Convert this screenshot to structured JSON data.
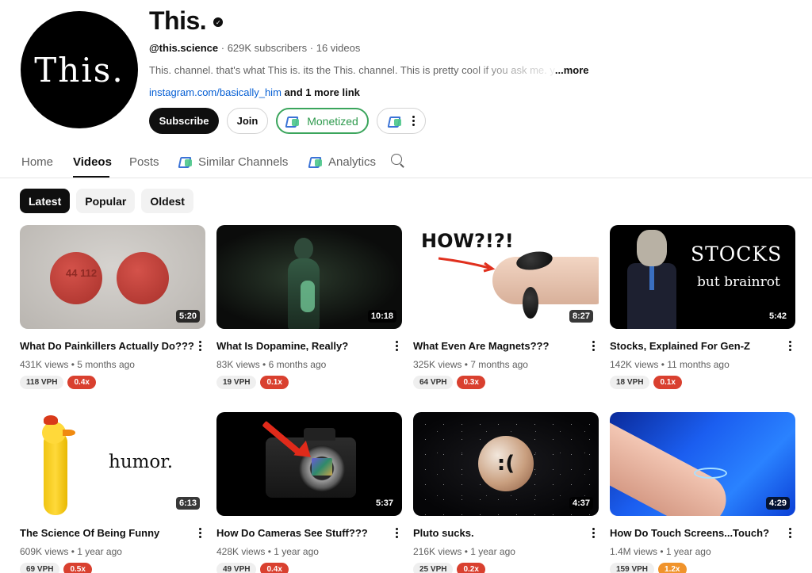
{
  "channel": {
    "name": "This.",
    "avatar_text": "This.",
    "handle": "@this.science",
    "subscribers": "629K subscribers",
    "videos_count": "16 videos",
    "description": "This. channel. that's what This is. its the This. channel. This is pretty cool if you ask me. y",
    "more_label": "...more",
    "link": "instagram.com/basically_him",
    "more_links": "and 1 more link"
  },
  "buttons": {
    "subscribe": "Subscribe",
    "join": "Join",
    "monetized": "Monetized"
  },
  "tabs": {
    "home": "Home",
    "videos": "Videos",
    "posts": "Posts",
    "similar": "Similar Channels",
    "analytics": "Analytics"
  },
  "filters": [
    "Latest",
    "Popular",
    "Oldest"
  ],
  "videos": [
    {
      "title": "What Do Painkillers Actually Do???",
      "views": "431K views",
      "age": "5 months ago",
      "duration": "5:20",
      "vph": "118 VPH",
      "ratio": "0.4x",
      "ratio_color": "#d9402f",
      "pill_text": "44 112"
    },
    {
      "title": "What Is Dopamine, Really?",
      "views": "83K views",
      "age": "6 months ago",
      "duration": "10:18",
      "vph": "19 VPH",
      "ratio": "0.1x",
      "ratio_color": "#d9402f"
    },
    {
      "title": "What Even Are Magnets???",
      "views": "325K views",
      "age": "7 months ago",
      "duration": "8:27",
      "vph": "64 VPH",
      "ratio": "0.3x",
      "ratio_color": "#d9402f",
      "thumb_text": "HOW?!?!"
    },
    {
      "title": "Stocks, Explained For Gen-Z",
      "views": "142K views",
      "age": "11 months ago",
      "duration": "5:42",
      "vph": "18 VPH",
      "ratio": "0.1x",
      "ratio_color": "#d9402f",
      "thumb_text": "STOCKS",
      "thumb_subtext": "but brainrot"
    },
    {
      "title": "The Science Of Being Funny",
      "views": "609K views",
      "age": "1 year ago",
      "duration": "6:13",
      "vph": "69 VPH",
      "ratio": "0.5x",
      "ratio_color": "#d9402f",
      "thumb_text": "humor."
    },
    {
      "title": "How Do Cameras See Stuff???",
      "views": "428K views",
      "age": "1 year ago",
      "duration": "5:37",
      "vph": "49 VPH",
      "ratio": "0.4x",
      "ratio_color": "#d9402f"
    },
    {
      "title": "Pluto sucks.",
      "views": "216K views",
      "age": "1 year ago",
      "duration": "4:37",
      "vph": "25 VPH",
      "ratio": "0.2x",
      "ratio_color": "#d9402f",
      "thumb_text": ":("
    },
    {
      "title": "How Do Touch Screens...Touch?",
      "views": "1.4M views",
      "age": "1 year ago",
      "duration": "4:29",
      "vph": "159 VPH",
      "ratio": "1.2x",
      "ratio_color": "#f0932b"
    }
  ]
}
